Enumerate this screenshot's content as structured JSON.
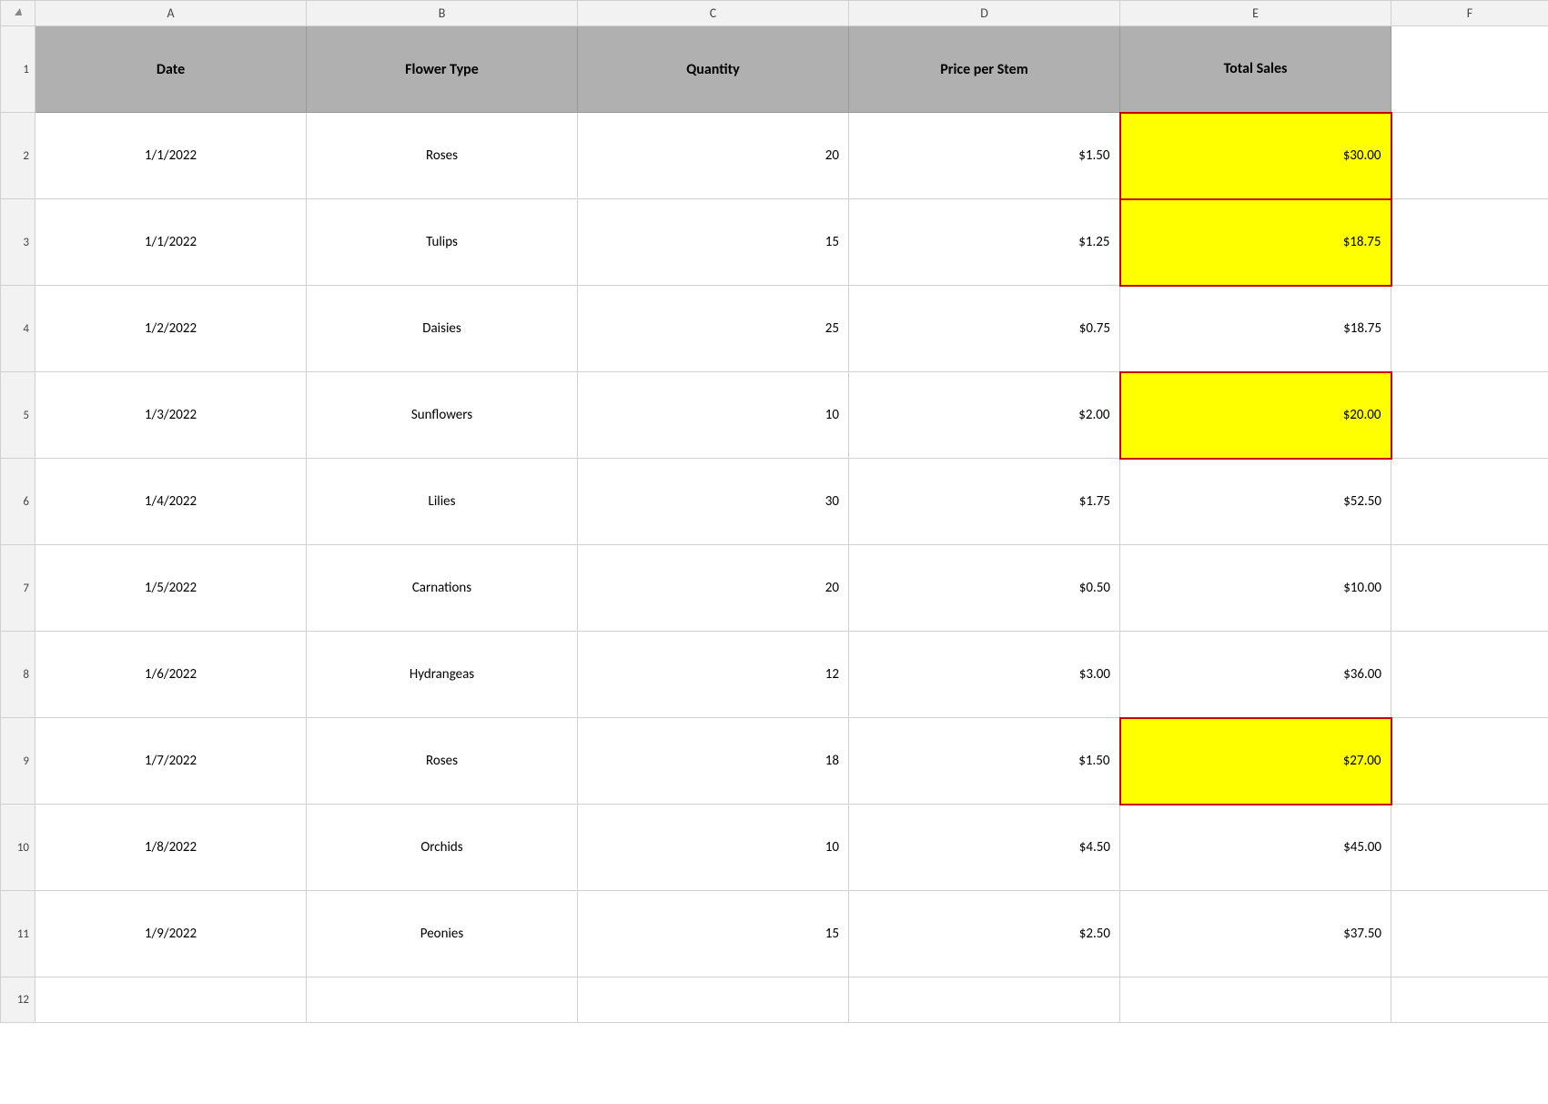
{
  "columns": {
    "indicator": "",
    "a": "A",
    "b": "B",
    "c": "C",
    "d": "D",
    "e": "E",
    "f": "F"
  },
  "headers": {
    "date": "Date",
    "flower_type": "Flower Type",
    "quantity": "Quantity",
    "price_per_stem": "Price per Stem",
    "total_sales": "Total Sales"
  },
  "rows": [
    {
      "row": "2",
      "date": "1/1/2022",
      "flower": "Roses",
      "qty": "20",
      "price": "$1.50",
      "total": "$30.00",
      "highlight": true
    },
    {
      "row": "3",
      "date": "1/1/2022",
      "flower": "Tulips",
      "qty": "15",
      "price": "$1.25",
      "total": "$18.75",
      "highlight": true
    },
    {
      "row": "4",
      "date": "1/2/2022",
      "flower": "Daisies",
      "qty": "25",
      "price": "$0.75",
      "total": "$18.75",
      "highlight": false
    },
    {
      "row": "5",
      "date": "1/3/2022",
      "flower": "Sunflowers",
      "qty": "10",
      "price": "$2.00",
      "total": "$20.00",
      "highlight": true
    },
    {
      "row": "6",
      "date": "1/4/2022",
      "flower": "Lilies",
      "qty": "30",
      "price": "$1.75",
      "total": "$52.50",
      "highlight": false
    },
    {
      "row": "7",
      "date": "1/5/2022",
      "flower": "Carnations",
      "qty": "20",
      "price": "$0.50",
      "total": "$10.00",
      "highlight": false
    },
    {
      "row": "8",
      "date": "1/6/2022",
      "flower": "Hydrangeas",
      "qty": "12",
      "price": "$3.00",
      "total": "$36.00",
      "highlight": false
    },
    {
      "row": "9",
      "date": "1/7/2022",
      "flower": "Roses",
      "qty": "18",
      "price": "$1.50",
      "total": "$27.00",
      "highlight": true
    },
    {
      "row": "10",
      "date": "1/8/2022",
      "flower": "Orchids",
      "qty": "10",
      "price": "$4.50",
      "total": "$45.00",
      "highlight": false
    },
    {
      "row": "11",
      "date": "1/9/2022",
      "flower": "Peonies",
      "qty": "15",
      "price": "$2.50",
      "total": "$37.50",
      "highlight": false
    }
  ]
}
